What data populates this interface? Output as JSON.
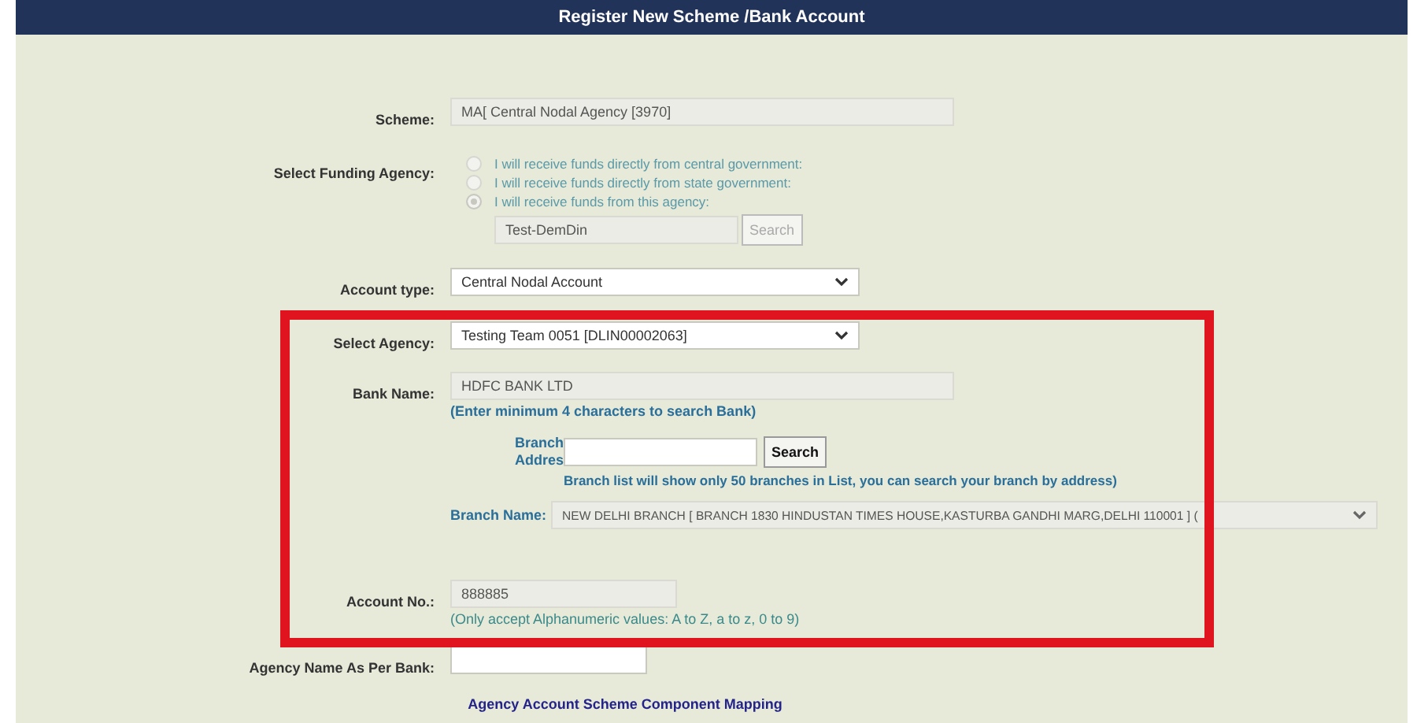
{
  "header": {
    "title": "Register New Scheme /Bank Account"
  },
  "fields": [
    {
      "kind": "text",
      "label": "Scheme:",
      "value": "MA[ Central Nodal Agency [3970]",
      "disabled": true
    },
    {
      "kind": "radios",
      "label": "Select Funding Agency:",
      "options": [
        {
          "label": "I will receive funds directly from central government:",
          "selected": false
        },
        {
          "label": "I will receive funds directly from state government:",
          "selected": false
        },
        {
          "label": "I will receive funds from this agency:",
          "selected": true
        }
      ],
      "agency": {
        "value": "Test-DemDin",
        "button": "Search",
        "disabled": true
      }
    },
    {
      "kind": "select",
      "label": "Account type:",
      "value": "Central Nodal Account",
      "disabled": false
    },
    {
      "kind": "select",
      "label": "Select Agency:",
      "value": "Testing Team 0051 [DLIN00002063]",
      "disabled": false
    },
    {
      "kind": "text",
      "label": "Bank Name:",
      "value": "HDFC BANK LTD",
      "disabled": true,
      "hint": "(Enter minimum 4 characters to search Bank)",
      "hint_bold": true
    },
    {
      "kind": "search",
      "label": "Branch Addres",
      "button": "Search",
      "hint": "Branch list will show only 50 branches in List, you can search your branch by address)"
    },
    {
      "kind": "inline-select",
      "label": "Branch Name:",
      "value": "NEW DELHI BRANCH [ BRANCH 1830 HINDUSTAN TIMES HOUSE,KASTURBA GANDHI MARG,DELHI 110001 ] (",
      "disabled": true
    },
    {
      "kind": "text",
      "label": "Account No.:",
      "value": "888885",
      "disabled": true,
      "hint": "(Only accept Alphanumeric values: A to Z, a to z, 0 to 9)",
      "hint_bold": false
    },
    {
      "kind": "text",
      "label": "Agency Name As Per Bank:",
      "disabled": false
    }
  ],
  "link": "Agency Account Scheme Component Mapping"
}
